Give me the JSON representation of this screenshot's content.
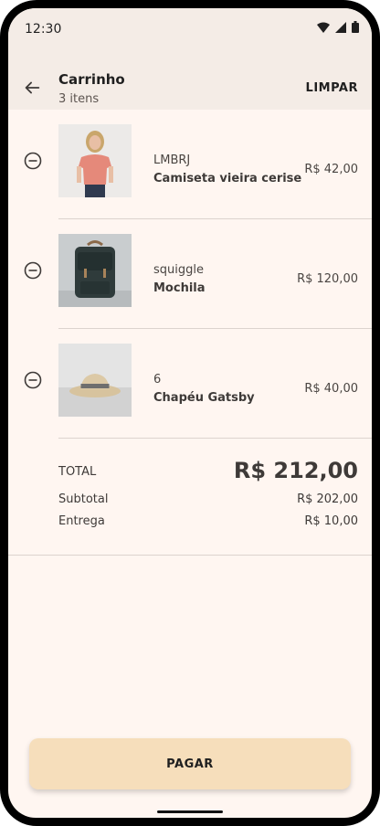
{
  "status_bar": {
    "time": "12:30"
  },
  "app_bar": {
    "title": "Carrinho",
    "subtitle": "3 itens",
    "clear_label": "LIMPAR"
  },
  "items": [
    {
      "vendor": "LMBRJ",
      "name": "Camiseta vieira cerise",
      "price": "R$ 42,00",
      "image": "woman-pink-tshirt"
    },
    {
      "vendor": "squiggle",
      "name": "Mochila",
      "price": "R$ 120,00",
      "image": "dark-backpack"
    },
    {
      "vendor": "6",
      "name": "Chapéu Gatsby",
      "price": "R$ 40,00",
      "image": "straw-hat"
    }
  ],
  "summary": {
    "total_label": "TOTAL",
    "total_value": "R$ 212,00",
    "subtotal_label": "Subtotal",
    "subtotal_value": "R$ 202,00",
    "shipping_label": "Entrega",
    "shipping_value": "R$ 10,00"
  },
  "checkout": {
    "label": "PAGAR"
  },
  "colors": {
    "background": "#FFF6F1",
    "app_bar": "#F4ECE6",
    "button": "#F6DEBB"
  }
}
